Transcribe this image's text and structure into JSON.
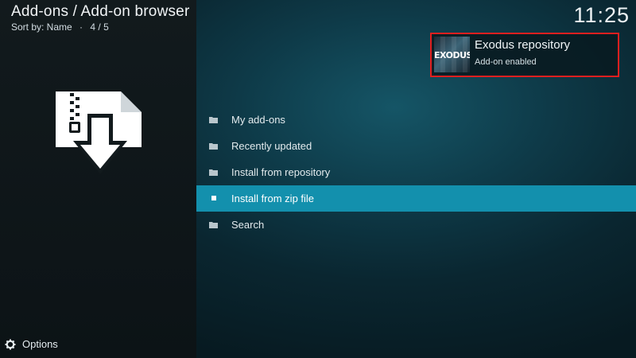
{
  "header": {
    "breadcrumb": "Add-ons / Add-on browser",
    "sort_label": "Sort by: Name",
    "separator": "·",
    "position": "4 / 5"
  },
  "clock": "11:25",
  "notification": {
    "title": "Exodus repository",
    "message": "Add-on enabled",
    "thumbnail_text": "EXODUS",
    "highlight_color": "#e21f1f"
  },
  "menu": {
    "items": [
      {
        "label": "My add-ons",
        "icon": "folder-icon"
      },
      {
        "label": "Recently updated",
        "icon": "folder-icon"
      },
      {
        "label": "Install from repository",
        "icon": "folder-icon"
      },
      {
        "label": "Install from zip file",
        "icon": "square-icon",
        "selected": true
      },
      {
        "label": "Search",
        "icon": "folder-icon"
      }
    ],
    "selected_color": "#1390ad"
  },
  "footer": {
    "options_label": "Options",
    "options_icon": "gear-icon"
  },
  "preview_icon": "zip-download-icon"
}
